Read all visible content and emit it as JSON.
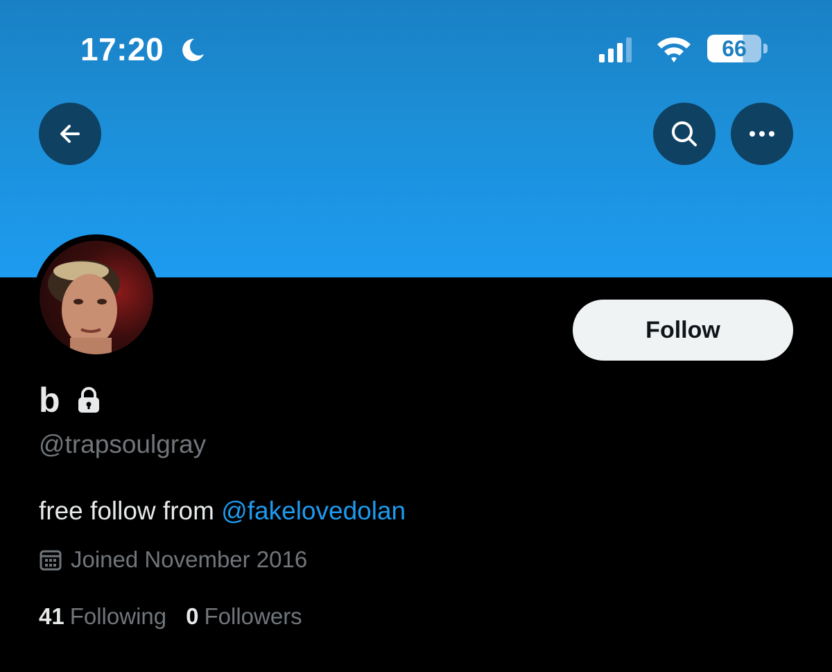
{
  "status_bar": {
    "time": "17:20",
    "battery": "66",
    "icons": [
      "moon-icon",
      "signal-icon",
      "wifi-icon",
      "battery-icon"
    ]
  },
  "header": {
    "icons": [
      "back-arrow-icon",
      "search-icon",
      "more-icon"
    ]
  },
  "colors": {
    "banner_top": "#1a80c4",
    "banner_bottom": "#1d9bf0",
    "nav_button": "#0f4163",
    "background": "#000000",
    "accent": "#1d9bf0",
    "text_primary": "#e7e9ea",
    "text_secondary": "#71767b",
    "follow_button_bg": "#eff3f4"
  },
  "profile": {
    "display_name": "b",
    "protected": true,
    "handle": "@trapsoulgray",
    "bio_text": "free follow from ",
    "bio_mention": "@fakelovedolan",
    "joined": "Joined November 2016",
    "following_count": "41",
    "following_label": "Following",
    "followers_count": "0",
    "followers_label": "Followers"
  },
  "actions": {
    "follow_label": "Follow"
  }
}
